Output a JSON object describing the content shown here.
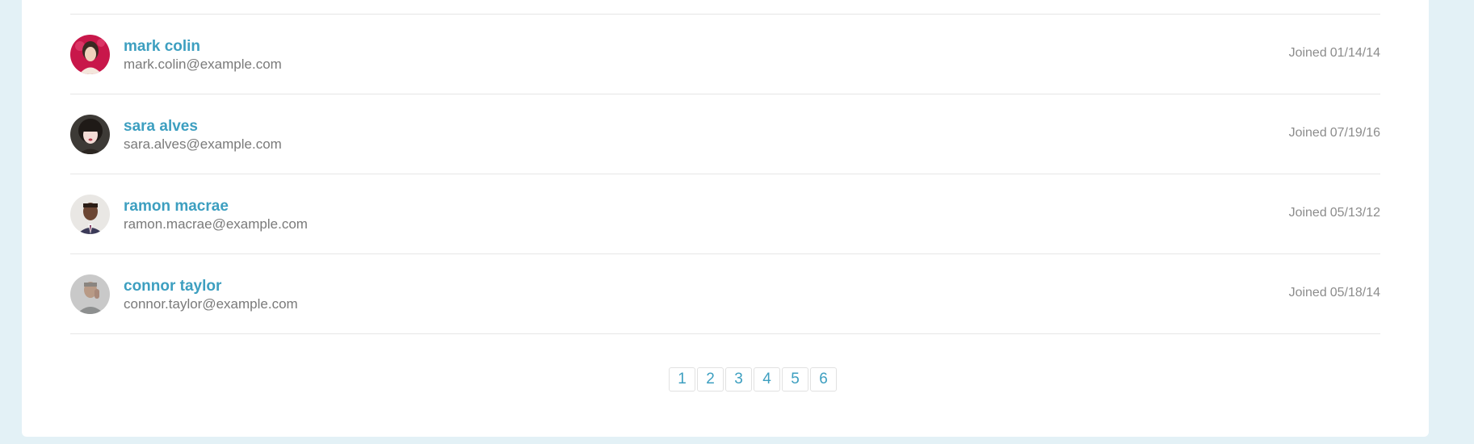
{
  "users": [
    {
      "name": "mark colin",
      "email": "mark.colin@example.com",
      "joined_prefix": "Joined",
      "joined_date": "01/14/14",
      "avatar_icon": "avatar-photo-icon"
    },
    {
      "name": "sara alves",
      "email": "sara.alves@example.com",
      "joined_prefix": "Joined",
      "joined_date": "07/19/16",
      "avatar_icon": "avatar-photo-icon"
    },
    {
      "name": "ramon macrae",
      "email": "ramon.macrae@example.com",
      "joined_prefix": "Joined",
      "joined_date": "05/13/12",
      "avatar_icon": "avatar-photo-icon"
    },
    {
      "name": "connor taylor",
      "email": "connor.taylor@example.com",
      "joined_prefix": "Joined",
      "joined_date": "05/18/14",
      "avatar_icon": "avatar-photo-icon"
    }
  ],
  "pagination": {
    "pages": [
      "1",
      "2",
      "3",
      "4",
      "5",
      "6"
    ]
  },
  "colors": {
    "background": "#e3f1f6",
    "card": "#ffffff",
    "accent": "#3d9fc0",
    "text_muted": "#7a7a7a",
    "divider": "#e6e6e6"
  }
}
